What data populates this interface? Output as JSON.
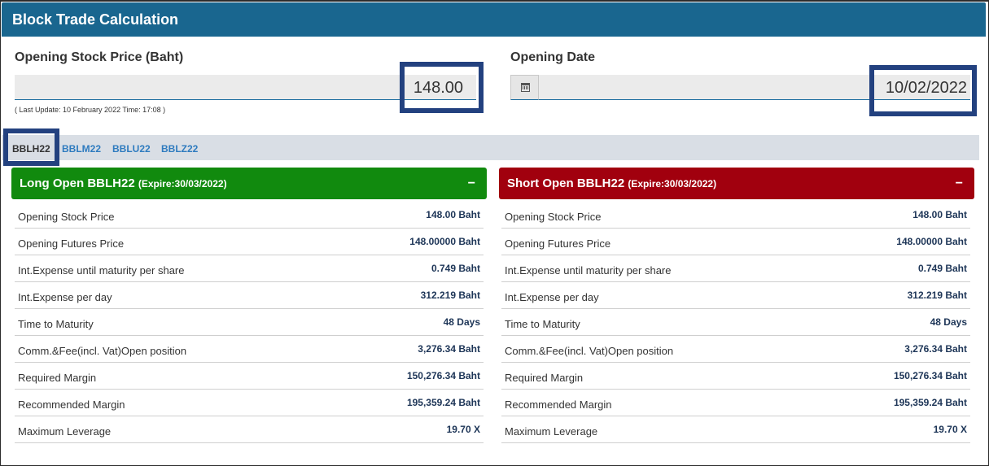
{
  "header": {
    "title": "Block Trade Calculation"
  },
  "stock_price": {
    "label": "Opening Stock Price (Baht)",
    "value": "148.00",
    "last_update": "( Last Update: 10 February 2022 Time: 17:08 )"
  },
  "opening_date": {
    "label": "Opening Date",
    "value": "10/02/2022",
    "icon": "calendar-icon"
  },
  "tabs": [
    {
      "label": "BBLH22",
      "active": true
    },
    {
      "label": "BBLM22",
      "active": false
    },
    {
      "label": "BBLU22",
      "active": false
    },
    {
      "label": "BBLZ22",
      "active": false
    }
  ],
  "long_panel": {
    "title": "Long Open BBLH22",
    "expire": "(Expire:30/03/2022)",
    "collapse": "−",
    "color": "#118a0e",
    "rows": [
      {
        "label": "Opening Stock Price",
        "value": "148.00 Baht"
      },
      {
        "label": "Opening Futures Price",
        "value": "148.00000 Baht"
      },
      {
        "label": "Int.Expense until maturity per share",
        "value": "0.749 Baht"
      },
      {
        "label": "Int.Expense per day",
        "value": "312.219 Baht"
      },
      {
        "label": "Time to Maturity",
        "value": "48 Days"
      },
      {
        "label": "Comm.&Fee(incl. Vat)Open position",
        "value": "3,276.34 Baht"
      },
      {
        "label": "Required Margin",
        "value": "150,276.34 Baht"
      },
      {
        "label": "Recommended Margin",
        "value": "195,359.24 Baht"
      },
      {
        "label": "Maximum Leverage",
        "value": "19.70 X"
      }
    ]
  },
  "short_panel": {
    "title": "Short Open BBLH22",
    "expire": "(Expire:30/03/2022)",
    "collapse": "−",
    "color": "#a1000e",
    "rows": [
      {
        "label": "Opening Stock Price",
        "value": "148.00 Baht"
      },
      {
        "label": "Opening Futures Price",
        "value": "148.00000 Baht"
      },
      {
        "label": "Int.Expense until maturity per share",
        "value": "0.749 Baht"
      },
      {
        "label": "Int.Expense per day",
        "value": "312.219 Baht"
      },
      {
        "label": "Time to Maturity",
        "value": "48 Days"
      },
      {
        "label": "Comm.&Fee(incl. Vat)Open position",
        "value": "3,276.34 Baht"
      },
      {
        "label": "Required Margin",
        "value": "150,276.34 Baht"
      },
      {
        "label": "Recommended Margin",
        "value": "195,359.24 Baht"
      },
      {
        "label": "Maximum Leverage",
        "value": "19.70 X"
      }
    ]
  },
  "colors": {
    "header": "#19668f",
    "highlight": "#23417f",
    "tab_link": "#2e7bbf"
  }
}
